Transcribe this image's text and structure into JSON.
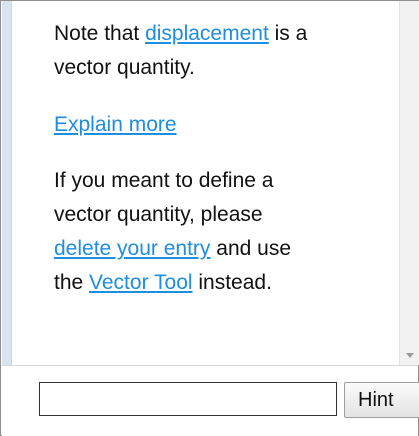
{
  "message": {
    "line1_prefix": "Note that ",
    "line1_link": "displacement",
    "line1_suffix": " is a",
    "line2": "vector quantity.",
    "explain_link": "Explain more",
    "line3": "If you meant to define a",
    "line4": "vector quantity, please",
    "line5_link": "delete your entry",
    "line5_suffix": " and use",
    "line6_prefix": "the ",
    "line6_link": "Vector Tool",
    "line6_suffix": " instead."
  },
  "input": {
    "value": "",
    "placeholder": ""
  },
  "hint_button": {
    "label": "Hint"
  },
  "colors": {
    "link": "#1e8ee0",
    "text": "#111111",
    "left_strip": "#d9e4f1"
  },
  "icons": {
    "scroll_down": "chevron-down-icon"
  }
}
